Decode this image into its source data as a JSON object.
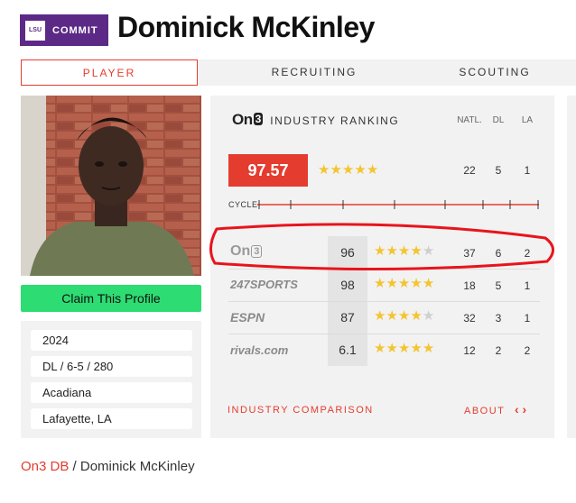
{
  "header": {
    "badge_logo": "LSU",
    "badge_text": "COMMIT",
    "player_name": "Dominick McKinley"
  },
  "tabs": [
    {
      "label": "PLAYER",
      "active": true
    },
    {
      "label": "RECRUITING",
      "active": false
    },
    {
      "label": "SCOUTING",
      "active": false
    }
  ],
  "profile": {
    "claim_label": "Claim This Profile",
    "info": [
      "2024",
      "DL / 6-5 / 280",
      "Acadiana",
      "Lafayette, LA"
    ]
  },
  "ranking": {
    "brand": "On3",
    "title": "INDUSTRY RANKING",
    "columns": [
      "NATL.",
      "DL",
      "LA"
    ],
    "industry": {
      "score": "97.57",
      "stars": 5,
      "natl": "22",
      "pos": "5",
      "state": "1"
    },
    "cycle_label": "CYCLE",
    "services": [
      {
        "name": "On3",
        "score": "96",
        "stars": 4,
        "natl": "37",
        "pos": "6",
        "state": "2"
      },
      {
        "name": "247SPORTS",
        "score": "98",
        "stars": 5,
        "natl": "18",
        "pos": "5",
        "state": "1"
      },
      {
        "name": "ESPN",
        "score": "87",
        "stars": 4,
        "natl": "32",
        "pos": "3",
        "state": "1"
      },
      {
        "name": "rivals.com",
        "score": "6.1",
        "stars": 5,
        "natl": "12",
        "pos": "2",
        "state": "2"
      }
    ],
    "comparison_label": "INDUSTRY COMPARISON",
    "about_label": "ABOUT"
  },
  "breadcrumb": {
    "root": "On3 DB",
    "separator": "/",
    "current": "Dominick McKinley"
  },
  "colors": {
    "accent_red": "#e43c2f",
    "lsu_purple": "#5c2a86",
    "claim_green": "#2ddc73",
    "star_gold": "#f4c430",
    "annotation_red": "#e8141c"
  }
}
